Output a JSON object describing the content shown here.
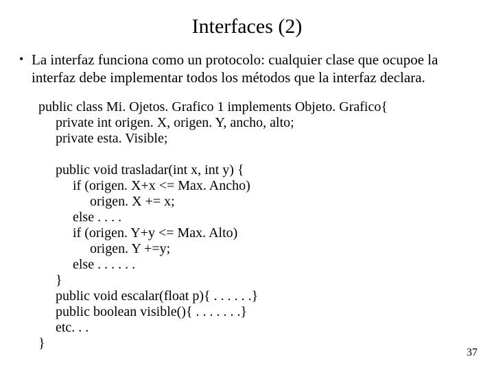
{
  "title": "Interfaces (2)",
  "bullet": "La interfaz funciona como un protocolo: cualquier clase que ocupoe la interfaz debe implementar todos los métodos que la interfaz declara.",
  "code": "public class Mi. Ojetos. Grafico 1 implements Objeto. Grafico{\n     private int origen. X, origen. Y, ancho, alto;\n     private esta. Visible;\n\n     public void trasladar(int x, int y) {\n          if (origen. X+x <= Max. Ancho)\n               origen. X += x;\n          else . . . .\n          if (origen. Y+y <= Max. Alto)\n               origen. Y +=y;\n          else . . . . . .\n     }\n     public void escalar(float p){ . . . . . .}\n     public boolean visible(){ . . . . . . .}\n     etc. . .\n}",
  "page_number": "37"
}
